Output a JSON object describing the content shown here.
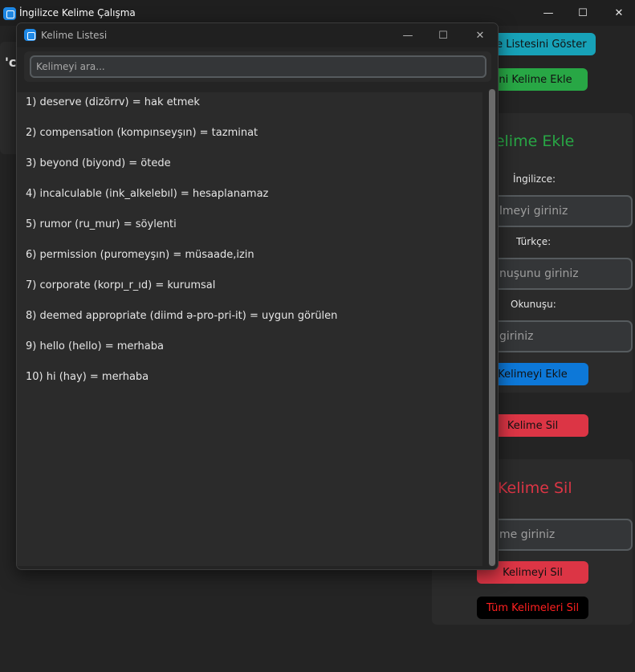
{
  "main_window": {
    "title": "İngilizce Kelime Çalışma",
    "controls": {
      "minimize": "—",
      "maximize": "☐",
      "close": "✕"
    },
    "left_panel_label": "'c",
    "show_list_button": "me Listesini Göster",
    "add_word_button": "eni Kelime Ekle",
    "add_panel": {
      "title": "i Kelime Ekle",
      "english_label": "İngilizce:",
      "english_placeholder": "lmeyi giriniz",
      "turkish_label": "Türkçe:",
      "turkish_placeholder": "nuşunu giriniz",
      "pronunciation_label": "Okunuşu:",
      "pronunciation_placeholder": "giriniz",
      "submit_button": "Kelimeyi Ekle"
    },
    "delete_word_button": "Kelime Sil",
    "delete_panel": {
      "title": "Kelime Sil",
      "word_placeholder": "me giriniz",
      "delete_button": "Kelimeyi Sil",
      "delete_all_button": "Tüm Kelimeleri Sil"
    }
  },
  "list_window": {
    "title": "Kelime Listesi",
    "controls": {
      "minimize": "—",
      "maximize": "☐",
      "close": "✕"
    },
    "search_placeholder": "Kelimeyi ara...",
    "words": [
      "1) deserve (dizörrv) = hak etmek",
      "2) compensation (kompınseyşın) = tazminat",
      "3) beyond (biyond) = ötede",
      "4) incalculable (ink_alkelebıl) = hesaplanamaz",
      "5) rumor (ru_mur) = söylenti",
      "6) permission (puromeyşın) = müsaade,izin",
      "7) corporate (korpı_r_ıd) = kurumsal",
      "8) deemed appropriate (diimd ə-pro-pri-it) = uygun görülen",
      "9) hello (hello) = merhaba",
      "10) hi (hay) = merhaba"
    ]
  },
  "colors": {
    "background": "#242424",
    "panel": "#2b2b2b",
    "cyan_button": "#17a2b8",
    "green": "#28a745",
    "blue_button": "#0d78d8",
    "red": "#dc3545",
    "black_button": "#000000",
    "delete_all_text": "#ff2020"
  }
}
